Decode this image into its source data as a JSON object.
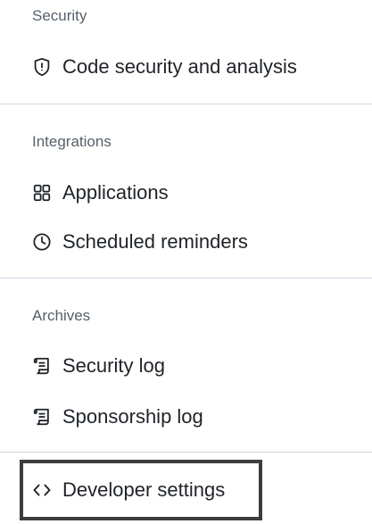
{
  "sections": [
    {
      "heading": "Security",
      "items": [
        {
          "label": "Code security and analysis",
          "icon": "shield-icon"
        }
      ]
    },
    {
      "heading": "Integrations",
      "items": [
        {
          "label": "Applications",
          "icon": "apps-grid-icon"
        },
        {
          "label": "Scheduled reminders",
          "icon": "clock-icon"
        }
      ]
    },
    {
      "heading": "Archives",
      "items": [
        {
          "label": "Security log",
          "icon": "log-icon"
        },
        {
          "label": "Sponsorship log",
          "icon": "log-icon"
        }
      ]
    }
  ],
  "developer_settings": {
    "label": "Developer settings",
    "icon": "code-icon"
  },
  "colors": {
    "text": "#1f2328",
    "heading": "#57606a",
    "divider": "#d0d7de",
    "highlight_border": "#3d3d3d"
  }
}
